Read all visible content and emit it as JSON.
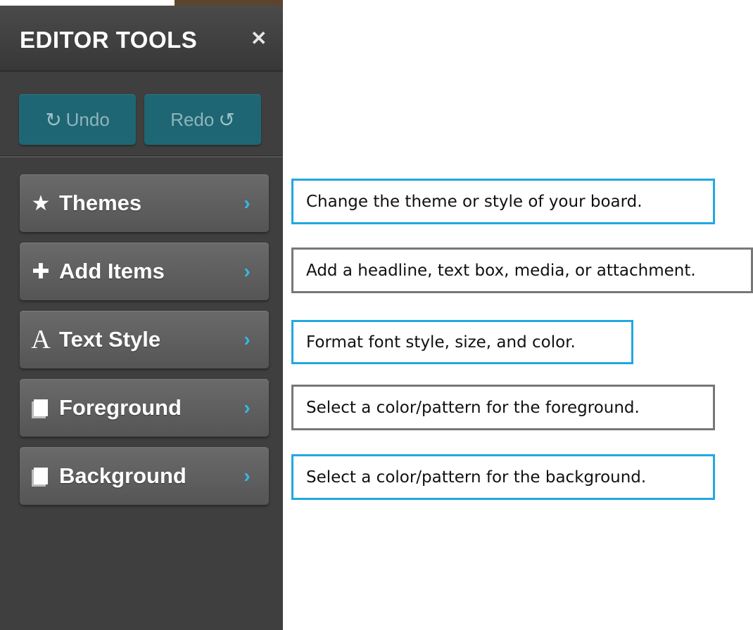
{
  "panel": {
    "title": "EDITOR TOOLS",
    "close_symbol": "✕",
    "undo_label": "Undo",
    "redo_label": "Redo",
    "undo_icon": "↻",
    "redo_icon": "↺"
  },
  "menu": [
    {
      "label": "Themes",
      "icon": "star-icon",
      "glyph": "★"
    },
    {
      "label": "Add Items",
      "icon": "plus-icon",
      "glyph": "✚"
    },
    {
      "label": "Text Style",
      "icon": "letter-a-icon",
      "glyph": "A"
    },
    {
      "label": "Foreground",
      "icon": "square-icon",
      "glyph": ""
    },
    {
      "label": "Background",
      "icon": "square-icon",
      "glyph": ""
    }
  ],
  "chevron": "›",
  "callouts": [
    {
      "text": "Change the theme or style of your board.",
      "border": "#21a8e0"
    },
    {
      "text": "Add a headline, text box, media, or attachment.",
      "border": "#777777"
    },
    {
      "text": "Format font style, size, and color.",
      "border": "#21a8e0"
    },
    {
      "text": "Select a color/pattern for the foreground.",
      "border": "#777777"
    },
    {
      "text": "Select a color/pattern for the background.",
      "border": "#21a8e0"
    }
  ],
  "colors": {
    "panel_bg": "#3f3f3f",
    "history_button": "#1e6673",
    "chevron": "#37b7e8",
    "menu_button": "#5f5f5f"
  }
}
